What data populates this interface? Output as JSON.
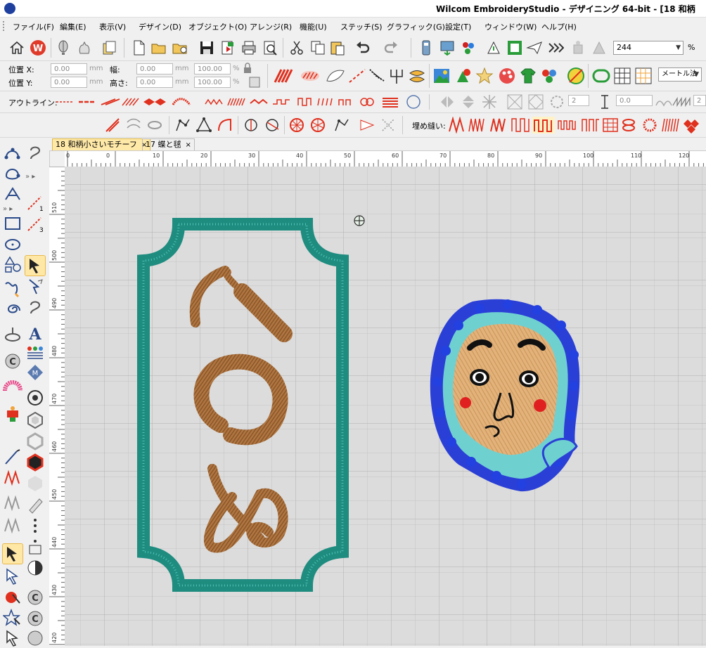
{
  "window": {
    "title": "Wilcom EmbroideryStudio - デザイニング 64-bit - [18 和柄"
  },
  "menu": [
    "ファイル(F)",
    "編集(E)",
    "表示(V)",
    "デザイン(D)",
    "オブジェクト(O)",
    "アレンジ(R)",
    "機能(U)",
    "ステッチ(S)",
    "グラフィック(G)",
    "設定(T)",
    "ウィンドウ(W)",
    "ヘルプ(H)"
  ],
  "toolbar": {
    "zoom_value": "244",
    "zoom_unit": "%"
  },
  "properties": {
    "pos_x_label": "位置 X:",
    "pos_x_value": "0.00",
    "pos_y_label": "位置 Y:",
    "pos_y_value": "0.00",
    "width_label": "幅:",
    "width_value": "0.00",
    "height_label": "高さ:",
    "height_value": "0.00",
    "unit_mm": "mm",
    "scale_x": "100.00",
    "scale_y": "100.00",
    "scale_unit": "%",
    "measure_mode": "メートル法"
  },
  "outline_bar": {
    "label": "アウトライン:",
    "spin1": "2",
    "spin2": "0.0",
    "spin3": "2"
  },
  "fill_bar": {
    "label": "埋め縫い:"
  },
  "tabs": [
    {
      "label": "18 和柄小さいモチーフ",
      "close": "×"
    },
    {
      "label": "17 蝶と毬",
      "close": "×"
    }
  ],
  "ruler": {
    "top": [
      "0",
      "0",
      "10",
      "20",
      "30",
      "40",
      "50",
      "60",
      "70",
      "80",
      "90",
      "100",
      "110",
      "120"
    ],
    "left": [
      "510",
      "500",
      "490",
      "480",
      "470",
      "460",
      "450",
      "440",
      "430",
      "420"
    ]
  },
  "left_tool_labels": {
    "a": "1",
    "b": "3"
  },
  "colors": {
    "frame": "#1f8c80",
    "letters": "#b07642",
    "hood_dark": "#2a3fd6",
    "hood_light": "#6fd0d0",
    "face": "#e2b27a",
    "canvas": "#dcdcdc",
    "grid": "#c4c4c4",
    "fill_icon": "#e0301e",
    "active_tab": "#ffe9a8"
  }
}
